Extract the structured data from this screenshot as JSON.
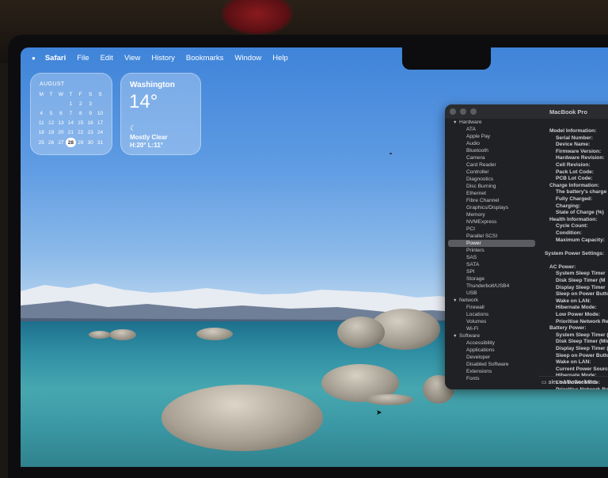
{
  "menubar": {
    "app_name": "Safari",
    "items": [
      "File",
      "Edit",
      "View",
      "History",
      "Bookmarks",
      "Window",
      "Help"
    ]
  },
  "calendar_widget": {
    "month": "AUGUST",
    "weekdays": [
      "M",
      "T",
      "W",
      "T",
      "F",
      "S",
      "S"
    ],
    "weeks": [
      [
        "",
        "",
        "",
        "1",
        "2",
        "3",
        ""
      ],
      [
        "4",
        "5",
        "6",
        "7",
        "8",
        "9",
        "10"
      ],
      [
        "11",
        "12",
        "13",
        "14",
        "15",
        "16",
        "17"
      ],
      [
        "18",
        "19",
        "20",
        "21",
        "22",
        "23",
        "24"
      ],
      [
        "25",
        "26",
        "27",
        "28",
        "29",
        "30",
        "31"
      ]
    ],
    "today": "28"
  },
  "weather_widget": {
    "city": "Washington",
    "temperature": "14°",
    "condition": "Mostly Clear",
    "high_low": "H:20° L:11°",
    "icon": "moon-icon"
  },
  "system_info": {
    "title": "MacBook Pro",
    "sidebar": [
      {
        "type": "category",
        "label": "Hardware"
      },
      {
        "type": "item",
        "label": "ATA"
      },
      {
        "type": "item",
        "label": "Apple Pay"
      },
      {
        "type": "item",
        "label": "Audio"
      },
      {
        "type": "item",
        "label": "Bluetooth"
      },
      {
        "type": "item",
        "label": "Camera"
      },
      {
        "type": "item",
        "label": "Card Reader"
      },
      {
        "type": "item",
        "label": "Controller"
      },
      {
        "type": "item",
        "label": "Diagnostics"
      },
      {
        "type": "item",
        "label": "Disc Burning"
      },
      {
        "type": "item",
        "label": "Ethernet"
      },
      {
        "type": "item",
        "label": "Fibre Channel"
      },
      {
        "type": "item",
        "label": "Graphics/Displays"
      },
      {
        "type": "item",
        "label": "Memory"
      },
      {
        "type": "item",
        "label": "NVMExpress"
      },
      {
        "type": "item",
        "label": "PCI"
      },
      {
        "type": "item",
        "label": "Parallel SCSI"
      },
      {
        "type": "item",
        "label": "Power",
        "selected": true
      },
      {
        "type": "item",
        "label": "Printers"
      },
      {
        "type": "item",
        "label": "SAS"
      },
      {
        "type": "item",
        "label": "SATA"
      },
      {
        "type": "item",
        "label": "SPI"
      },
      {
        "type": "item",
        "label": "Storage"
      },
      {
        "type": "item",
        "label": "Thunderbolt/USB4"
      },
      {
        "type": "item",
        "label": "USB"
      },
      {
        "type": "category",
        "label": "Network"
      },
      {
        "type": "item",
        "label": "Firewall"
      },
      {
        "type": "item",
        "label": "Locations"
      },
      {
        "type": "item",
        "label": "Volumes"
      },
      {
        "type": "item",
        "label": "Wi-Fi"
      },
      {
        "type": "category",
        "label": "Software"
      },
      {
        "type": "item",
        "label": "Accessibility"
      },
      {
        "type": "item",
        "label": "Applications"
      },
      {
        "type": "item",
        "label": "Developer"
      },
      {
        "type": "item",
        "label": "Disabled Software"
      },
      {
        "type": "item",
        "label": "Extensions"
      },
      {
        "type": "item",
        "label": "Fonts"
      }
    ],
    "detail_rows": [
      {
        "indent": 1,
        "text": "Model Information:"
      },
      {
        "indent": 2,
        "text": "Serial Number:"
      },
      {
        "indent": 2,
        "text": "Device Name:"
      },
      {
        "indent": 2,
        "text": "Firmware Version:"
      },
      {
        "indent": 2,
        "text": "Hardware Revision:"
      },
      {
        "indent": 2,
        "text": "Cell Revision:"
      },
      {
        "indent": 2,
        "text": "Pack Lot Code:"
      },
      {
        "indent": 2,
        "text": "PCB Lot Code:"
      },
      {
        "indent": 1,
        "text": "Charge Information:"
      },
      {
        "indent": 2,
        "text": "The battery's charge"
      },
      {
        "indent": 2,
        "text": "Fully Charged:"
      },
      {
        "indent": 2,
        "text": "Charging:"
      },
      {
        "indent": 2,
        "text": "State of Charge (%)"
      },
      {
        "indent": 1,
        "text": "Health Information:"
      },
      {
        "indent": 2,
        "text": "Cycle Count:"
      },
      {
        "indent": 2,
        "text": "Condition:"
      },
      {
        "indent": 2,
        "text": "Maximum Capacity:"
      },
      {
        "indent": 0,
        "text": ""
      },
      {
        "indent": 0,
        "text": "System Power Settings:"
      },
      {
        "indent": 0,
        "text": ""
      },
      {
        "indent": 1,
        "text": "AC Power:"
      },
      {
        "indent": 2,
        "text": "System Sleep Timer"
      },
      {
        "indent": 2,
        "text": "Disk Sleep Timer (M"
      },
      {
        "indent": 2,
        "text": "Display Sleep Timer"
      },
      {
        "indent": 2,
        "text": "Sleep on Power Butto"
      },
      {
        "indent": 2,
        "text": "Wake on LAN:"
      },
      {
        "indent": 2,
        "text": "Hibernate Mode:"
      },
      {
        "indent": 2,
        "text": "Low Power Mode:"
      },
      {
        "indent": 2,
        "text": "Prioritise Network Re"
      },
      {
        "indent": 1,
        "text": "Battery Power:"
      },
      {
        "indent": 2,
        "text": "System Sleep Timer (M"
      },
      {
        "indent": 2,
        "text": "Disk Sleep Timer (Min"
      },
      {
        "indent": 2,
        "text": "Display Sleep Timer ("
      },
      {
        "indent": 2,
        "text": "Sleep on Power Butto"
      },
      {
        "indent": 2,
        "text": "Wake on LAN:"
      },
      {
        "indent": 2,
        "text": "Current Power Source"
      },
      {
        "indent": 2,
        "text": "Hibernate Mode:"
      },
      {
        "indent": 2,
        "text": "Low Power Mode:"
      },
      {
        "indent": 2,
        "text": "Prioritise Network Rea"
      },
      {
        "indent": 2,
        "text": "Reduce Brightness:"
      }
    ],
    "status_path": "alex's MacBook Pro"
  },
  "colors": {
    "sky_top": "#3f84d9",
    "water": "#2f8ea3",
    "window_bg": "#1f2124",
    "selection": "#5a5c61"
  }
}
